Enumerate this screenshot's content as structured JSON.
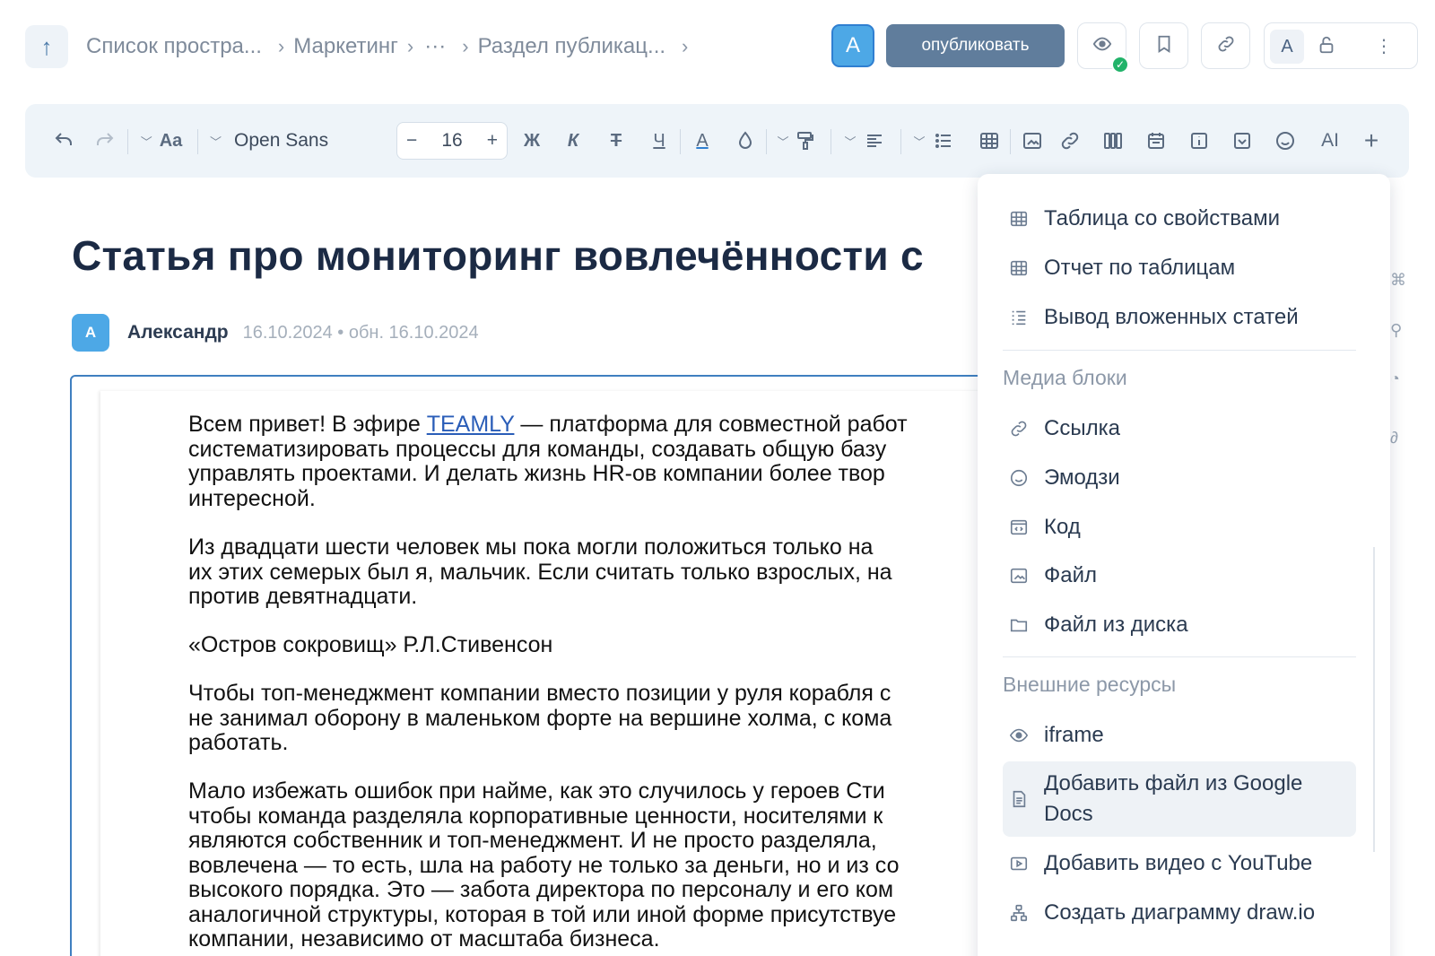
{
  "topbar": {
    "breadcrumb": {
      "space": "Список простра...",
      "section": "Маркетинг",
      "ellipsis": "···",
      "page": "Раздел публикац..."
    },
    "avatar_letter": "A",
    "publish_label": "опубликовать",
    "group_avatar_letter": "A",
    "status_color": "#22b36a"
  },
  "toolbar": {
    "font_family": "Open Sans",
    "font_size": "16",
    "bold": "Ж",
    "italic": "К",
    "strike": "Т",
    "underline": "Ч",
    "text_color": "A",
    "text_style": "Aa",
    "ai": "AI"
  },
  "article": {
    "title": "Статья про мониторинг вовлечённости с",
    "author_initial": "A",
    "author": "Александр",
    "dates": "16.10.2024 • обн. 16.10.2024",
    "p1_before": "Всем привет! В эфире ",
    "p1_link": "TEAMLY",
    "p1_after": " — платформа для совместной работ\nсистематизировать процессы для команды, создавать общую базу\nуправлять проектами. И делать жизнь HR-ов компании более твор\nинтересной.",
    "p2": "Из двадцати шести человек мы пока могли положиться только на\nих этих семерых был я, мальчик. Если считать только взрослых, на\nпротив девятнадцати.",
    "p3": "«Остров сокровищ» Р.Л.Стивенсон",
    "p4": "Чтобы топ-менеджмент компании вместо позиции у руля корабля с\nне занимал оборону в маленьком форте на вершине холма, с кома\nработать.",
    "p5": "Мало избежать ошибок при найме, как это случилось у героев Сти\nчтобы команда разделяла корпоративные ценности, носителями к\nявляются собственник и топ-менеджмент. И не просто разделяла,\nвовлечена — то есть, шла на работу не только за деньги, но и из со\nвысокого порядка. Это — забота директора по персоналу и его ком\nаналогичной структуры, которая в той или иной форме присутствуе\nкомпании, независимо от масштаба бизнеса."
  },
  "menu": {
    "items_top": [
      {
        "label": "Таблица со свойствами",
        "icon": "table-props-icon"
      },
      {
        "label": "Отчет по таблицам",
        "icon": "table-report-icon"
      },
      {
        "label": "Вывод вложенных статей",
        "icon": "nested-list-icon"
      }
    ],
    "section_media": "Медиа блоки",
    "items_media": [
      {
        "label": "Ссылка",
        "icon": "link-icon"
      },
      {
        "label": "Эмодзи",
        "icon": "emoji-icon"
      },
      {
        "label": "Код",
        "icon": "code-icon"
      },
      {
        "label": "Файл",
        "icon": "image-file-icon"
      },
      {
        "label": "Файл из диска",
        "icon": "folder-icon"
      }
    ],
    "section_external": "Внешние ресурсы",
    "items_external": [
      {
        "label": "iframe",
        "icon": "eye-icon"
      },
      {
        "label": "Добавить файл из Google Docs",
        "icon": "google-docs-icon"
      },
      {
        "label": "Добавить видео с YouTube",
        "icon": "youtube-icon"
      },
      {
        "label": "Создать диаграмму draw.io",
        "icon": "diagram-icon"
      }
    ]
  }
}
